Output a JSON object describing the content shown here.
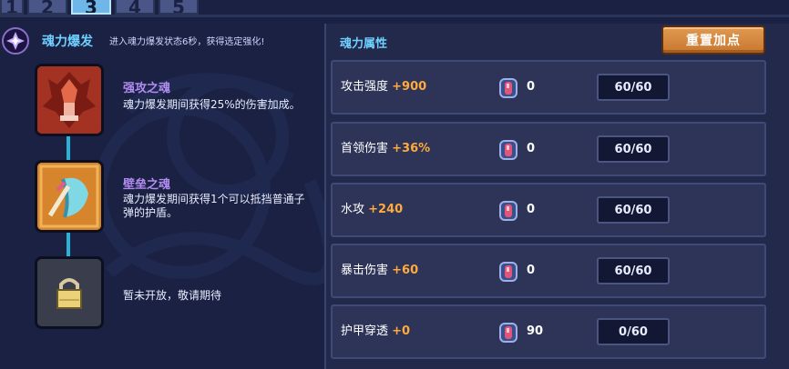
{
  "tabs": [
    {
      "label": "1",
      "active": false
    },
    {
      "label": "2",
      "active": false
    },
    {
      "label": "3",
      "active": true
    },
    {
      "label": "4",
      "active": false
    },
    {
      "label": "5",
      "active": false
    }
  ],
  "burst": {
    "title": "魂力爆发",
    "subtitle": "进入魂力爆发状态6秒，获得选定强化!"
  },
  "souls": [
    {
      "name": "强攻之魂",
      "desc": "魂力爆发期间获得25%的伤害加成。",
      "icon": "flame-knight-icon"
    },
    {
      "name": "壁垒之魂",
      "desc": "魂力爆发期间获得1个可以抵挡普通子弹的护盾。",
      "icon": "shield-icon"
    },
    {
      "name": "",
      "desc": "暂未开放，敬请期待",
      "icon": "lock-icon"
    }
  ],
  "attributes": {
    "title": "魂力属性",
    "reset_label": "重置加点",
    "rows": [
      {
        "name": "攻击强度",
        "bonus": "+900",
        "gems": "0",
        "level": "60/60"
      },
      {
        "name": "首领伤害",
        "bonus": "+36%",
        "gems": "0",
        "level": "60/60"
      },
      {
        "name": "水攻",
        "bonus": "+240",
        "gems": "0",
        "level": "60/60"
      },
      {
        "name": "暴击伤害",
        "bonus": "+60",
        "gems": "0",
        "level": "60/60"
      },
      {
        "name": "护甲穿透",
        "bonus": "+0",
        "gems": "90",
        "level": "0/60"
      }
    ]
  },
  "colors": {
    "accent_cyan": "#6fd0ff",
    "bonus_orange": "#ffaa3c",
    "soul_name_purple": "#b18cf0",
    "button_orange": "#d98a43"
  }
}
